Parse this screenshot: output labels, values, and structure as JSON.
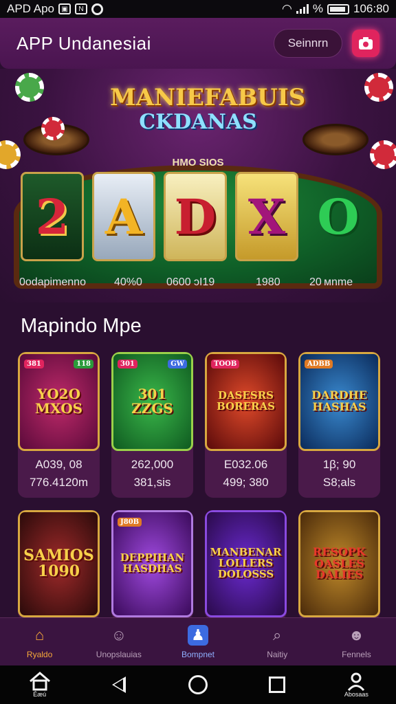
{
  "status_bar": {
    "left_text": "APD Apo",
    "time": "106:80",
    "percent_text": "%"
  },
  "header": {
    "title": "APP  Undanesiai",
    "signin_label": "Seinnrn",
    "camera_glyph": "0"
  },
  "hero": {
    "logo_line1": "MANIEFABUIS",
    "logo_line2": "CKDANAS",
    "subtitle": "HMO SIOS",
    "reels": [
      "2",
      "A",
      "D",
      "X",
      "O"
    ],
    "stats": [
      "0odapimenno",
      "40%0",
      "0600 ɔI19",
      "1980",
      "20 мnme"
    ]
  },
  "section": {
    "title": "Mapindo Mpe"
  },
  "games": [
    {
      "art": "YO2O MXOS",
      "tag_left": "381",
      "tag_right": "118",
      "line1": "А039, 08",
      "line2": "776.4120m"
    },
    {
      "art": "301 ZZGS",
      "tag_left": "301",
      "tag_right": "GW",
      "line1": "262,000",
      "line2": "381,sis"
    },
    {
      "art": "DASESRS BORERAS",
      "tag_left": "TOOB",
      "tag_right": "",
      "line1": "Е032.06",
      "line2": "499; 380"
    },
    {
      "art": "DARDHE HASHAS",
      "tag_left": "ADBB",
      "tag_right": "",
      "line1": "1β; 90",
      "line2": "S8;als"
    },
    {
      "art": "SAMIOS 1090",
      "tag_left": "",
      "tag_right": "",
      "line1": "",
      "line2": ""
    },
    {
      "art": "DEPPIHAN HASDHAS",
      "tag_left": "J80B",
      "tag_right": "",
      "line1": "",
      "line2": ""
    },
    {
      "art": "MANBENAR LOLLERS DOLOSSS",
      "tag_left": "",
      "tag_right": "",
      "line1": "",
      "line2": ""
    },
    {
      "art": "RESOPK OASLES DALIES",
      "tag_left": "",
      "tag_right": "",
      "line1": "",
      "line2": ""
    }
  ],
  "bottom_nav": [
    {
      "label": "Ryaldo",
      "icon": "home-icon",
      "glyph": "⌂"
    },
    {
      "label": "Unopslauias",
      "icon": "smile-icon",
      "glyph": "☺"
    },
    {
      "label": "Bompnet",
      "icon": "user-box-icon",
      "glyph": "♟"
    },
    {
      "label": "Naitiy",
      "icon": "search-icon",
      "glyph": "⌕"
    },
    {
      "label": "Fennels",
      "icon": "profile-icon",
      "glyph": "☻"
    }
  ],
  "system_nav": {
    "left_label": "Éæú",
    "right_label": "Abosaas"
  },
  "colors": {
    "accent": "#e0245e",
    "active_nav": "#f6a93a",
    "background": "#2a0f30"
  }
}
